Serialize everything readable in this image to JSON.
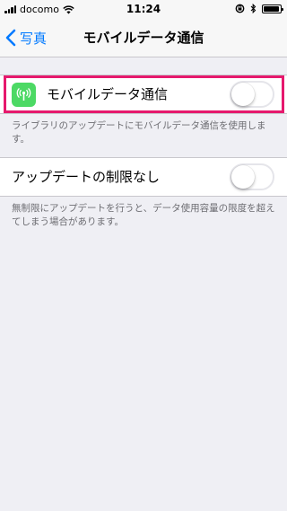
{
  "status_bar": {
    "carrier": "docomo",
    "time": "11:24",
    "battery_level": 0.95
  },
  "nav": {
    "back_label": "写真",
    "title": "モバイルデータ通信"
  },
  "sections": {
    "mobile_data": {
      "label": "モバイルデータ通信",
      "toggle_on": false,
      "footer": "ライブラリのアップデートにモバイルデータ通信を使用します。"
    },
    "unlimited_updates": {
      "label": "アップデートの制限なし",
      "toggle_on": false,
      "footer": "無制限にアップデートを行うと、データ使用容量の限度を超えてしまう場合があります。"
    }
  },
  "colors": {
    "accent": "#007aff",
    "highlight": "#e6196d",
    "app_icon": "#4cd964",
    "background": "#efeff4"
  },
  "icons": {
    "app": "antenna-icon",
    "back": "chevron-left-icon"
  }
}
